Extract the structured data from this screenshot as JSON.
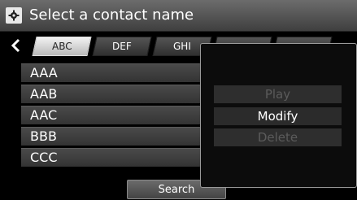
{
  "header": {
    "title": "Select a contact name",
    "icon": "gear-icon"
  },
  "tabs": [
    {
      "label": "ABC"
    },
    {
      "label": "DEF"
    },
    {
      "label": "GHI"
    }
  ],
  "contacts": [
    "AAA",
    "AAB",
    "AAC",
    "BBB",
    "CCC"
  ],
  "search_label": "Search",
  "popup": {
    "play_label": "Play",
    "modify_label": "Modify",
    "delete_label": "Delete"
  }
}
